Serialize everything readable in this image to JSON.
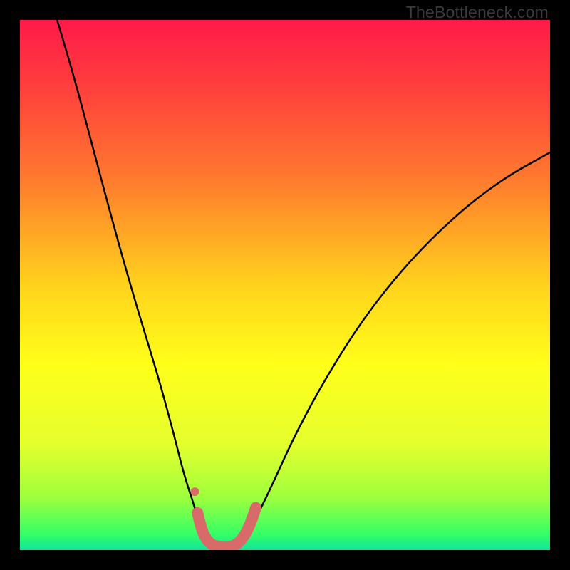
{
  "watermark": "TheBottleneck.com",
  "chart_data": {
    "type": "line",
    "title": "",
    "xlabel": "",
    "ylabel": "",
    "xlim": [
      0,
      100
    ],
    "ylim": [
      0,
      100
    ],
    "background_gradient": {
      "stops": [
        {
          "pos": 0.0,
          "color": "#ff1a4a"
        },
        {
          "pos": 0.12,
          "color": "#ff3d3d"
        },
        {
          "pos": 0.3,
          "color": "#ff7a2e"
        },
        {
          "pos": 0.5,
          "color": "#ffd21c"
        },
        {
          "pos": 0.65,
          "color": "#ffff1a"
        },
        {
          "pos": 0.8,
          "color": "#e4ff2e"
        },
        {
          "pos": 0.9,
          "color": "#9fff3c"
        },
        {
          "pos": 0.97,
          "color": "#35ff66"
        },
        {
          "pos": 1.0,
          "color": "#11e59b"
        }
      ]
    },
    "series": [
      {
        "name": "bottleneck-curve",
        "stroke": "#000000",
        "points": [
          {
            "x": 7,
            "y": 100
          },
          {
            "x": 10,
            "y": 90
          },
          {
            "x": 14,
            "y": 75
          },
          {
            "x": 18,
            "y": 60
          },
          {
            "x": 22,
            "y": 46
          },
          {
            "x": 26,
            "y": 33
          },
          {
            "x": 29,
            "y": 22
          },
          {
            "x": 31,
            "y": 14
          },
          {
            "x": 33,
            "y": 8
          },
          {
            "x": 34,
            "y": 4
          },
          {
            "x": 35,
            "y": 2
          },
          {
            "x": 37,
            "y": 0.5
          },
          {
            "x": 40,
            "y": 0.5
          },
          {
            "x": 42,
            "y": 2
          },
          {
            "x": 44,
            "y": 5
          },
          {
            "x": 47,
            "y": 11
          },
          {
            "x": 52,
            "y": 22
          },
          {
            "x": 58,
            "y": 33
          },
          {
            "x": 65,
            "y": 44
          },
          {
            "x": 73,
            "y": 54
          },
          {
            "x": 82,
            "y": 63
          },
          {
            "x": 91,
            "y": 70
          },
          {
            "x": 100,
            "y": 75
          }
        ]
      },
      {
        "name": "optimal-marker",
        "stroke": "#d86a6a",
        "stroke_width": 16,
        "points": [
          {
            "x": 33.5,
            "y": 7
          },
          {
            "x": 34.5,
            "y": 3
          },
          {
            "x": 36,
            "y": 1
          },
          {
            "x": 38,
            "y": 0.5
          },
          {
            "x": 40,
            "y": 0.5
          },
          {
            "x": 42,
            "y": 2
          },
          {
            "x": 43.5,
            "y": 5
          },
          {
            "x": 44.5,
            "y": 8
          }
        ],
        "dot": {
          "x": 33,
          "y": 11,
          "r": 6
        }
      }
    ]
  }
}
